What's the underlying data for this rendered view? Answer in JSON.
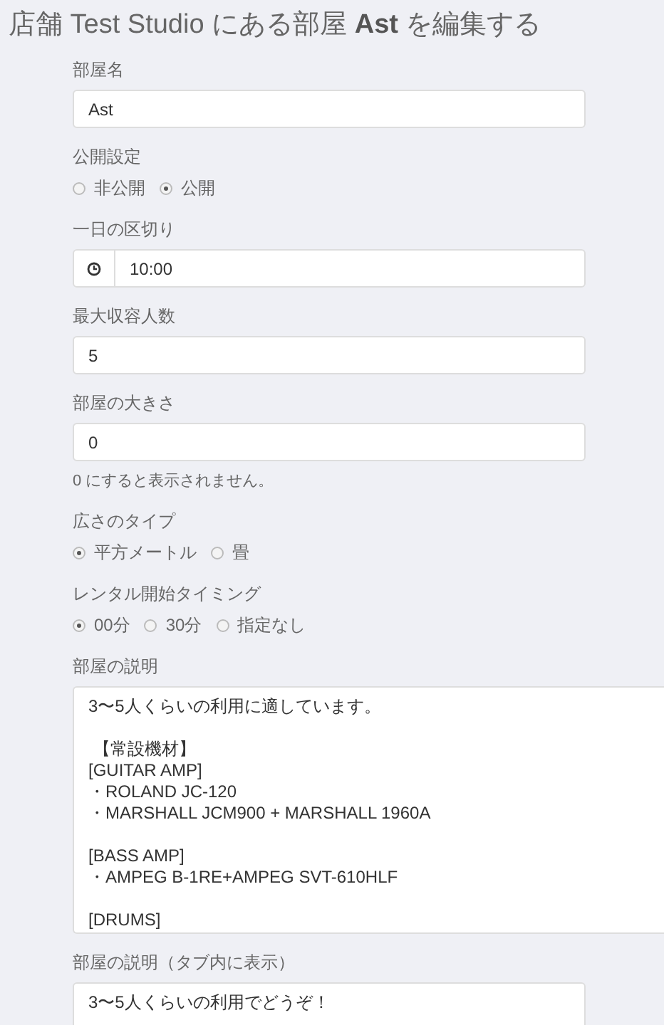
{
  "title": {
    "prefix": "店舗 Test Studio にある部屋 ",
    "name": "Ast",
    "suffix": " を編集する"
  },
  "fields": [
    {
      "kind": "text",
      "label": "部屋名",
      "value": "Ast"
    },
    {
      "kind": "radio",
      "label": "公開設定",
      "options": [
        {
          "label": "非公開",
          "selected": false
        },
        {
          "label": "公開",
          "selected": true
        }
      ]
    },
    {
      "kind": "time",
      "label": "一日の区切り",
      "value": "10:00"
    },
    {
      "kind": "text",
      "label": "最大収容人数",
      "value": "5"
    },
    {
      "kind": "text",
      "label": "部屋の大きさ",
      "value": "0",
      "help": "0 にすると表示されません。"
    },
    {
      "kind": "radio",
      "label": "広さのタイプ",
      "options": [
        {
          "label": "平方メートル",
          "selected": true
        },
        {
          "label": "畳",
          "selected": false
        }
      ]
    },
    {
      "kind": "radio",
      "label": "レンタル開始タイミング",
      "options": [
        {
          "label": "00分",
          "selected": true
        },
        {
          "label": "30分",
          "selected": false
        },
        {
          "label": "指定なし",
          "selected": false
        }
      ]
    },
    {
      "kind": "textarea_resized",
      "label": "部屋の説明",
      "paragraphs": [
        [
          "3〜5人くらいの利用に適しています。"
        ],
        [
          " 【常設機材】",
          "[GUITAR AMP]",
          "・ROLAND JC-120",
          "・MARSHALL JCM900 + MARSHALL 1960A"
        ],
        [
          "[BASS AMP]",
          "・AMPEG B-1RE+AMPEG SVT-610HLF"
        ],
        [
          "[DRUMS]"
        ]
      ]
    },
    {
      "kind": "textarea",
      "label": "部屋の説明（タブ内に表示）",
      "paragraphs": [
        [
          "3〜5人くらいの利用でどうぞ！"
        ]
      ]
    }
  ]
}
